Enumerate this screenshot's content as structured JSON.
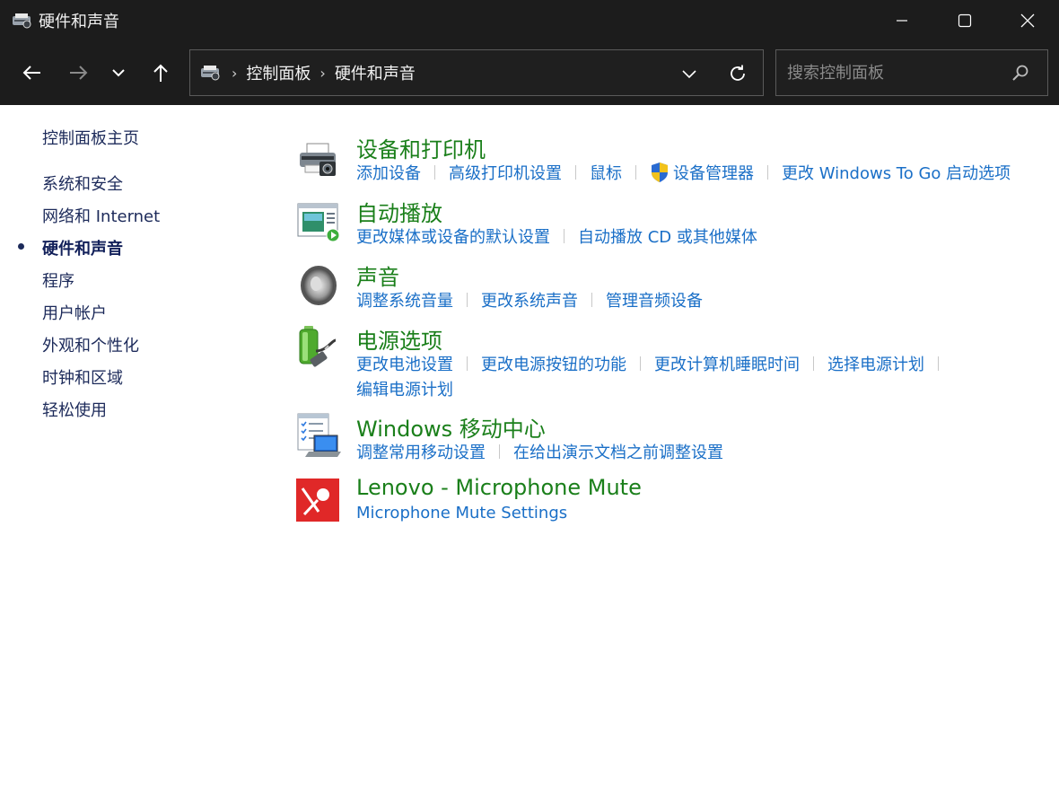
{
  "window": {
    "title": "硬件和声音"
  },
  "nav": {
    "breadcrumb": [
      "控制面板",
      "硬件和声音"
    ],
    "search_placeholder": "搜索控制面板"
  },
  "sidebar": {
    "home": "控制面板主页",
    "items": [
      {
        "label": "系统和安全",
        "current": false
      },
      {
        "label": "网络和 Internet",
        "current": false
      },
      {
        "label": "硬件和声音",
        "current": true
      },
      {
        "label": "程序",
        "current": false
      },
      {
        "label": "用户帐户",
        "current": false
      },
      {
        "label": "外观和个性化",
        "current": false
      },
      {
        "label": "时钟和区域",
        "current": false
      },
      {
        "label": "轻松使用",
        "current": false
      }
    ]
  },
  "categories": [
    {
      "title": "设备和打印机",
      "icon": "printer-icon",
      "links": [
        "添加设备",
        "高级打印机设置",
        "鼠标",
        "设备管理器",
        "更改 Windows To Go 启动选项"
      ]
    },
    {
      "title": "自动播放",
      "icon": "autoplay-icon",
      "links": [
        "更改媒体或设备的默认设置",
        "自动播放 CD 或其他媒体"
      ]
    },
    {
      "title": "声音",
      "icon": "speaker-icon",
      "links": [
        "调整系统音量",
        "更改系统声音",
        "管理音频设备"
      ]
    },
    {
      "title": "电源选项",
      "icon": "battery-icon",
      "links": [
        "更改电池设置",
        "更改电源按钮的功能",
        "更改计算机睡眠时间",
        "选择电源计划",
        "编辑电源计划"
      ]
    },
    {
      "title": "Windows 移动中心",
      "icon": "mobility-center-icon",
      "links": [
        "调整常用移动设置",
        "在给出演示文档之前调整设置"
      ]
    },
    {
      "title": "Lenovo - Microphone Mute",
      "icon": "microphone-mute-icon",
      "links": [
        "Microphone Mute Settings"
      ]
    }
  ],
  "colors": {
    "titlebar": "#1c1c1c",
    "category_title": "#1a7f1a",
    "link": "#1a6fc7",
    "sidebar_text": "#1c2a5a"
  }
}
